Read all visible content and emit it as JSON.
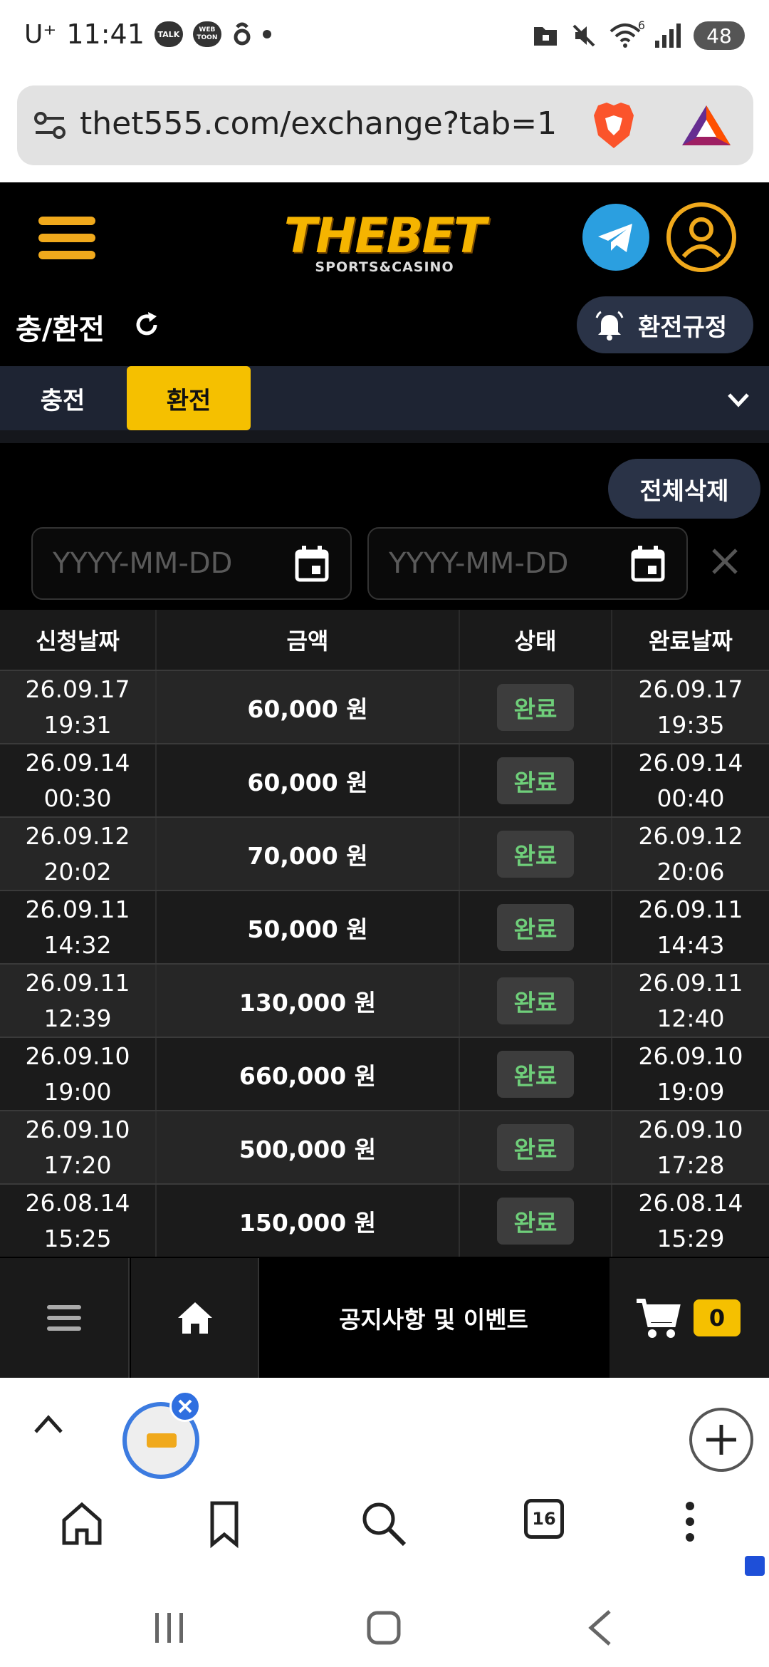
{
  "status_bar": {
    "carrier": "U⁺",
    "time": "11:41",
    "app_icons": [
      "talk-icon",
      "webtoon-icon",
      "threads-icon"
    ],
    "right_icons": [
      "folder-lock-icon",
      "mute-icon",
      "wifi-icon",
      "signal-icon"
    ],
    "wifi_band": "6",
    "battery": "48",
    "talk_label": "TALK",
    "webtoon_label": "WEB TOON"
  },
  "browser": {
    "url": "thet555.com/exchange?tab=1"
  },
  "site_header": {
    "logo_text": "THEBET",
    "logo_sub": "SPORTS&CASINO",
    "accent": "#f0a91c"
  },
  "page": {
    "title": "충/환전",
    "rules_button": "환전규정"
  },
  "tabs": {
    "items": [
      {
        "label": "충전",
        "active": false
      },
      {
        "label": "환전",
        "active": true
      }
    ]
  },
  "controls": {
    "clear_all": "전체삭제",
    "date_from_placeholder": "YYYY-MM-DD",
    "date_to_placeholder": "YYYY-MM-DD"
  },
  "table": {
    "headers": [
      "신청날짜",
      "금액",
      "상태",
      "완료날짜"
    ],
    "rows": [
      {
        "req_date": "26.09.17",
        "req_time": "19:31",
        "amount": "60,000 원",
        "status": "완료",
        "done_date": "26.09.17",
        "done_time": "19:35"
      },
      {
        "req_date": "26.09.14",
        "req_time": "00:30",
        "amount": "60,000 원",
        "status": "완료",
        "done_date": "26.09.14",
        "done_time": "00:40"
      },
      {
        "req_date": "26.09.12",
        "req_time": "20:02",
        "amount": "70,000 원",
        "status": "완료",
        "done_date": "26.09.12",
        "done_time": "20:06"
      },
      {
        "req_date": "26.09.11",
        "req_time": "14:32",
        "amount": "50,000 원",
        "status": "완료",
        "done_date": "26.09.11",
        "done_time": "14:43"
      },
      {
        "req_date": "26.09.11",
        "req_time": "12:39",
        "amount": "130,000 원",
        "status": "완료",
        "done_date": "26.09.11",
        "done_time": "12:40"
      },
      {
        "req_date": "26.09.10",
        "req_time": "19:00",
        "amount": "660,000 원",
        "status": "완료",
        "done_date": "26.09.10",
        "done_time": "19:09"
      },
      {
        "req_date": "26.09.10",
        "req_time": "17:20",
        "amount": "500,000 원",
        "status": "완료",
        "done_date": "26.09.10",
        "done_time": "17:28"
      },
      {
        "req_date": "26.08.14",
        "req_time": "15:25",
        "amount": "150,000 원",
        "status": "완료",
        "done_date": "26.08.14",
        "done_time": "15:29"
      }
    ]
  },
  "site_nav": {
    "notice": "공지사항 및 이벤트",
    "cart_count": "0"
  },
  "browser_bottom": {
    "tab_count": "16",
    "icons": [
      "home-icon",
      "bookmark-icon",
      "search-icon",
      "tabs-icon",
      "more-icon"
    ]
  }
}
